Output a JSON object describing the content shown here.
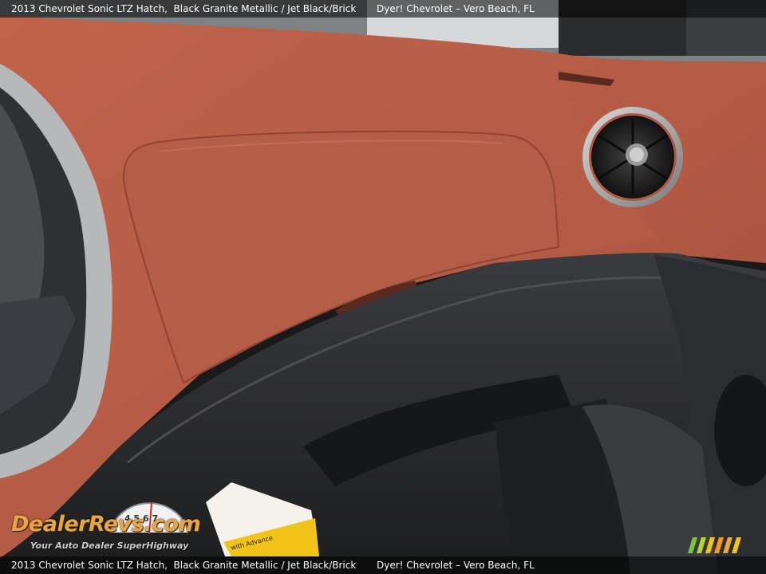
{
  "caption": {
    "vehicle": "2013 Chevrolet Sonic LTZ Hatch,",
    "colors": "Black Granite Metallic / Jet Black/Brick",
    "dealer": "Dyer! Chevrolet – Vero Beach, FL"
  },
  "watermark": {
    "brand": "DealerRevs.com",
    "tagline": "Your Auto Dealer SuperHighway",
    "gauge_digits": "4 5 6 7"
  },
  "sticker_text": "with Advance",
  "colors": {
    "dash_brick": "#b25a45",
    "trim_black": "#2a2b2d",
    "bezel_silver": "#a8a8a8",
    "logo_orange": "#e9a640"
  }
}
